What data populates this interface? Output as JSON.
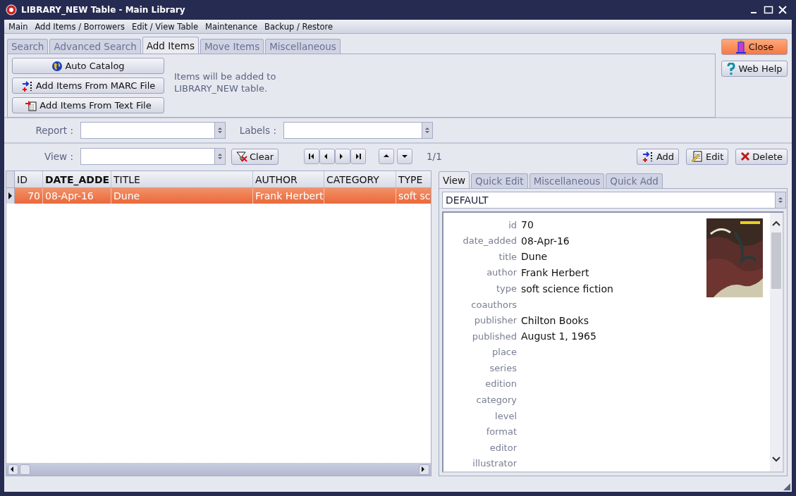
{
  "window": {
    "title": "LIBRARY_NEW Table - Main Library"
  },
  "menu": [
    "Main",
    "Add Items / Borrowers",
    "Edit / View Table",
    "Maintenance",
    "Backup / Restore"
  ],
  "tabs": [
    {
      "label": "Search",
      "selected": false
    },
    {
      "label": "Advanced Search",
      "selected": false
    },
    {
      "label": "Add Items",
      "selected": true
    },
    {
      "label": "Move Items",
      "selected": false
    },
    {
      "label": "Miscellaneous",
      "selected": false
    }
  ],
  "add_buttons": [
    {
      "kind": "globe",
      "label": "Auto Catalog"
    },
    {
      "kind": "marc",
      "label": "Add Items From MARC File"
    },
    {
      "kind": "text",
      "label": "Add Items From Text File"
    }
  ],
  "info_text": "Items will be added to\nLIBRARY_NEW table.",
  "side_buttons": [
    {
      "kind": "close",
      "label": "Close",
      "highlighted": true
    },
    {
      "kind": "help",
      "label": "Web Help",
      "highlighted": false
    }
  ],
  "report": {
    "label": "Report :"
  },
  "labels": {
    "label": "Labels :"
  },
  "view": {
    "label": "View :"
  },
  "clear_button": "Clear",
  "record_counter": "1/1",
  "record_buttons": [
    {
      "kind": "add",
      "label": "Add"
    },
    {
      "kind": "edit",
      "label": "Edit"
    },
    {
      "kind": "delete",
      "label": "Delete"
    }
  ],
  "table": {
    "columns": [
      {
        "label": "ID",
        "kind": "number",
        "bold": false
      },
      {
        "label": "DATE_ADDE",
        "kind": "text",
        "bold": true
      },
      {
        "label": "TITLE",
        "kind": "text",
        "bold": false
      },
      {
        "label": "AUTHOR",
        "kind": "text",
        "bold": false
      },
      {
        "label": "CATEGORY",
        "kind": "text",
        "bold": false
      },
      {
        "label": "TYPE",
        "kind": "text",
        "bold": false
      }
    ],
    "rows": [
      {
        "selected": true,
        "cells": [
          "70",
          "08-Apr-16",
          "Dune",
          "Frank Herbert",
          "",
          "soft sc"
        ]
      }
    ]
  },
  "detail_tabs": [
    {
      "label": "View",
      "selected": true
    },
    {
      "label": "Quick Edit",
      "selected": false
    },
    {
      "label": "Miscellaneous",
      "selected": false
    },
    {
      "label": "Quick Add",
      "selected": false
    }
  ],
  "detail_view": "DEFAULT",
  "fields": [
    {
      "label": "id",
      "value": "70"
    },
    {
      "label": "date_added",
      "value": "08-Apr-16"
    },
    {
      "label": "title",
      "value": "Dune"
    },
    {
      "label": "author",
      "value": "Frank Herbert"
    },
    {
      "label": "type",
      "value": "soft science fiction"
    },
    {
      "label": "coauthors"
    },
    {
      "label": "publisher",
      "value": "Chilton Books"
    },
    {
      "label": "published",
      "value": "August 1, 1965"
    },
    {
      "label": "place"
    },
    {
      "label": "series"
    },
    {
      "label": "edition"
    },
    {
      "label": "category"
    },
    {
      "label": "level"
    },
    {
      "label": "format"
    },
    {
      "label": "editor"
    },
    {
      "label": "illustrator"
    }
  ],
  "cover": {
    "kind": "picture"
  }
}
